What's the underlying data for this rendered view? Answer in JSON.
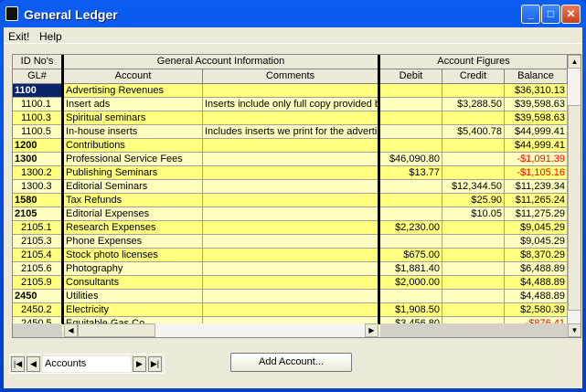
{
  "window": {
    "title": "General Ledger",
    "buttons": [
      "minimize",
      "maximize",
      "close"
    ]
  },
  "menu": [
    "Exit!",
    "Help"
  ],
  "grid": {
    "group_headers": [
      "ID No's",
      "General Account Information",
      "Account Figures"
    ],
    "columns": [
      "GL#",
      "Account",
      "Comments",
      "Debit",
      "Credit",
      "Balance"
    ],
    "rows": [
      {
        "gl": "1100",
        "bold": true,
        "selected": true,
        "account": "Advertising Revenues",
        "comments": "",
        "debit": "",
        "credit": "",
        "balance": "$36,310.13"
      },
      {
        "gl": "1100.1",
        "account": "Insert ads",
        "comments": "Inserts include only full copy provided by",
        "debit": "",
        "credit": "$3,288.50",
        "balance": "$39,598.63"
      },
      {
        "gl": "1100.3",
        "account": "Spiritual seminars",
        "comments": "",
        "debit": "",
        "credit": "",
        "balance": "$39,598.63"
      },
      {
        "gl": "1100.5",
        "account": "In-house inserts",
        "comments": "Includes inserts we print for the advertisers",
        "debit": "",
        "credit": "$5,400.78",
        "balance": "$44,999.41"
      },
      {
        "gl": "1200",
        "bold": true,
        "account": "Contributions",
        "comments": "",
        "debit": "",
        "credit": "",
        "balance": "$44,999.41"
      },
      {
        "gl": "1300",
        "bold": true,
        "account": "Professional Service Fees",
        "comments": "",
        "debit": "$46,090.80",
        "credit": "",
        "balance": "-$1,091.39"
      },
      {
        "gl": "1300.2",
        "account": "Publishing Seminars",
        "comments": "",
        "debit": "$13.77",
        "credit": "",
        "balance": "-$1,105.16"
      },
      {
        "gl": "1300.3",
        "account": "Editorial Seminars",
        "comments": "",
        "debit": "",
        "credit": "$12,344.50",
        "balance": "$11,239.34"
      },
      {
        "gl": "1580",
        "bold": true,
        "account": "Tax Refunds",
        "comments": "",
        "debit": "",
        "credit": "$25.90",
        "balance": "$11,265.24"
      },
      {
        "gl": "2105",
        "bold": true,
        "account": "Editorial Expenses",
        "comments": "",
        "debit": "",
        "credit": "$10.05",
        "balance": "$11,275.29"
      },
      {
        "gl": "2105.1",
        "account": "Research Expenses",
        "comments": "",
        "debit": "$2,230.00",
        "credit": "",
        "balance": "$9,045.29"
      },
      {
        "gl": "2105.3",
        "account": "Phone Expenses",
        "comments": "",
        "debit": "",
        "credit": "",
        "balance": "$9,045.29"
      },
      {
        "gl": "2105.4",
        "account": "Stock photo licenses",
        "comments": "",
        "debit": "$675.00",
        "credit": "",
        "balance": "$8,370.29"
      },
      {
        "gl": "2105.6",
        "account": "Photography",
        "comments": "",
        "debit": "$1,881.40",
        "credit": "",
        "balance": "$6,488.89"
      },
      {
        "gl": "2105.9",
        "account": "Consultants",
        "comments": "",
        "debit": "$2,000.00",
        "credit": "",
        "balance": "$4,488.89"
      },
      {
        "gl": "2450",
        "bold": true,
        "account": "Utilities",
        "comments": "",
        "debit": "",
        "credit": "",
        "balance": "$4,488.89"
      },
      {
        "gl": "2450.2",
        "account": "Electricity",
        "comments": "",
        "debit": "$1,908.50",
        "credit": "",
        "balance": "$2,580.39"
      },
      {
        "gl": "2450.5",
        "account": "Equitable Gas Co",
        "comments": "",
        "debit": "$3,456.80",
        "credit": "",
        "balance": "-$876.41"
      }
    ]
  },
  "navigator": {
    "label": "Accounts"
  },
  "add_button": "Add Account...",
  "colors": {
    "row_dark": "#ffff80",
    "row_light": "#ffffc0",
    "selected": "#0a246a",
    "negative": "#ff0000"
  }
}
